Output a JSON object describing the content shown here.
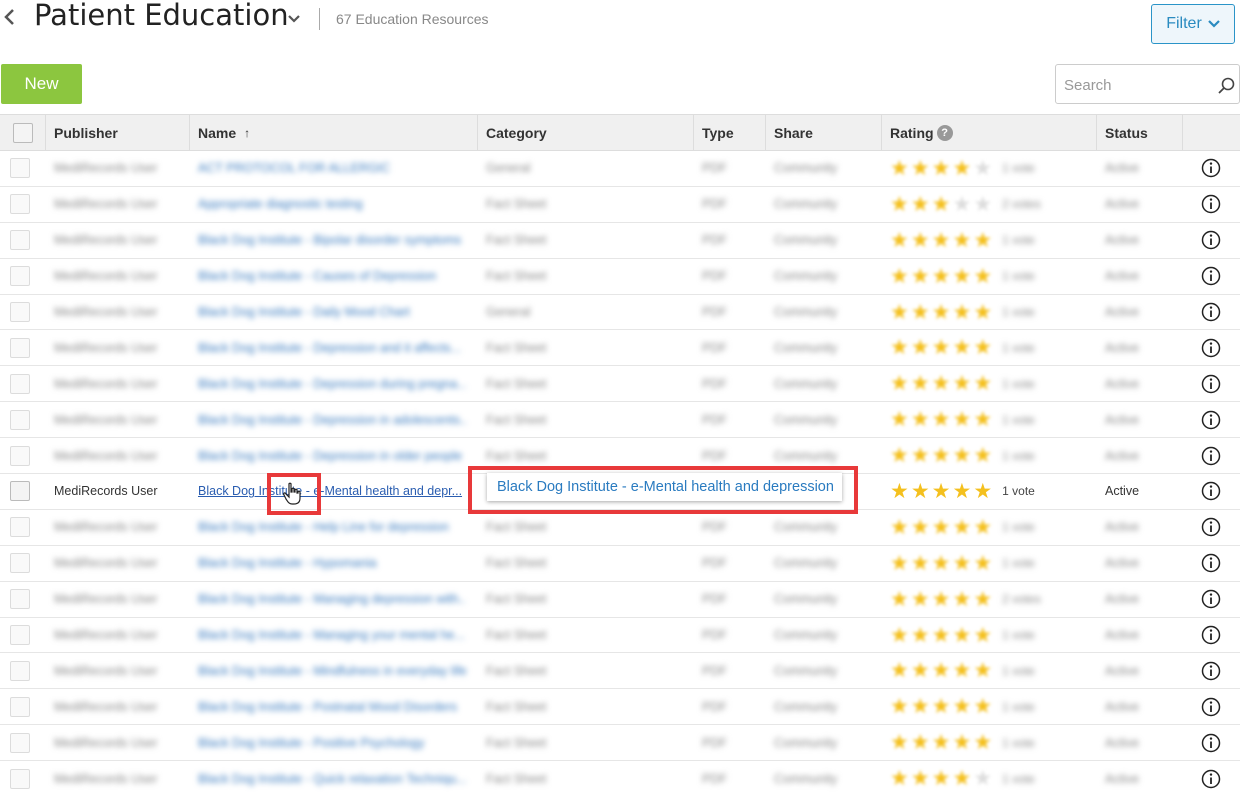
{
  "header": {
    "title": "Patient Education",
    "resource_count": "67 Education Resources",
    "filter_label": "Filter"
  },
  "toolbar": {
    "new_label": "New",
    "search_placeholder": "Search"
  },
  "columns": {
    "publisher": "Publisher",
    "name": "Name",
    "name_sort": "↑",
    "category": "Category",
    "type": "Type",
    "share": "Share",
    "rating": "Rating",
    "rating_help": "?",
    "status": "Status"
  },
  "active_row": {
    "publisher": "MediRecords User",
    "name": "Black Dog Institute - e-Mental health and depr...",
    "rating": 5,
    "votes": "1 vote",
    "status": "Active"
  },
  "tooltip": {
    "text": "Black Dog Institute - e-Mental health and depression"
  },
  "rows": [
    {
      "publisher": "MediRecords User",
      "name": "ACT PROTOCOL FOR ALLERGIC",
      "category": "General",
      "type": "PDF",
      "share": "Community",
      "rating": 4,
      "votes": "1 vote",
      "status": "Active"
    },
    {
      "publisher": "MediRecords User",
      "name": "Appropriate diagnostic testing",
      "category": "Fact Sheet",
      "type": "PDF",
      "share": "Community",
      "rating": 3,
      "votes": "2 votes",
      "status": "Active"
    },
    {
      "publisher": "MediRecords User",
      "name": "Black Dog Institute - Bipolar disorder symptoms",
      "category": "Fact Sheet",
      "type": "PDF",
      "share": "Community",
      "rating": 5,
      "votes": "1 vote",
      "status": "Active"
    },
    {
      "publisher": "MediRecords User",
      "name": "Black Dog Institute - Causes of Depression",
      "category": "Fact Sheet",
      "type": "PDF",
      "share": "Community",
      "rating": 5,
      "votes": "1 vote",
      "status": "Active"
    },
    {
      "publisher": "MediRecords User",
      "name": "Black Dog Institute - Daily Mood Chart",
      "category": "General",
      "type": "PDF",
      "share": "Community",
      "rating": 5,
      "votes": "1 vote",
      "status": "Active"
    },
    {
      "publisher": "MediRecords User",
      "name": "Black Dog Institute - Depression and it affects...",
      "category": "Fact Sheet",
      "type": "PDF",
      "share": "Community",
      "rating": 5,
      "votes": "1 vote",
      "status": "Active"
    },
    {
      "publisher": "MediRecords User",
      "name": "Black Dog Institute - Depression during pregna...",
      "category": "Fact Sheet",
      "type": "PDF",
      "share": "Community",
      "rating": 5,
      "votes": "1 vote",
      "status": "Active"
    },
    {
      "publisher": "MediRecords User",
      "name": "Black Dog Institute - Depression in adolescents...",
      "category": "Fact Sheet",
      "type": "PDF",
      "share": "Community",
      "rating": 5,
      "votes": "1 vote",
      "status": "Active"
    },
    {
      "publisher": "MediRecords User",
      "name": "Black Dog Institute - Depression in older people",
      "category": "Fact Sheet",
      "type": "PDF",
      "share": "Community",
      "rating": 5,
      "votes": "1 vote",
      "status": "Active"
    },
    {
      "publisher": "MediRecords User",
      "name": "Black Dog Institute - Help Line for depression",
      "category": "Fact Sheet",
      "type": "PDF",
      "share": "Community",
      "rating": 5,
      "votes": "1 vote",
      "status": "Active"
    },
    {
      "publisher": "MediRecords User",
      "name": "Black Dog Institute - Hypomania",
      "category": "Fact Sheet",
      "type": "PDF",
      "share": "Community",
      "rating": 5,
      "votes": "1 vote",
      "status": "Active"
    },
    {
      "publisher": "MediRecords User",
      "name": "Black Dog Institute - Managing depression with...",
      "category": "Fact Sheet",
      "type": "PDF",
      "share": "Community",
      "rating": 5,
      "votes": "2 votes",
      "status": "Active"
    },
    {
      "publisher": "MediRecords User",
      "name": "Black Dog Institute - Managing your mental he...",
      "category": "Fact Sheet",
      "type": "PDF",
      "share": "Community",
      "rating": 5,
      "votes": "1 vote",
      "status": "Active"
    },
    {
      "publisher": "MediRecords User",
      "name": "Black Dog Institute - Mindfulness in everyday life",
      "category": "Fact Sheet",
      "type": "PDF",
      "share": "Community",
      "rating": 5,
      "votes": "1 vote",
      "status": "Active"
    },
    {
      "publisher": "MediRecords User",
      "name": "Black Dog Institute - Postnatal Mood Disorders",
      "category": "Fact Sheet",
      "type": "PDF",
      "share": "Community",
      "rating": 5,
      "votes": "1 vote",
      "status": "Active"
    },
    {
      "publisher": "MediRecords User",
      "name": "Black Dog Institute - Positive Psychology",
      "category": "Fact Sheet",
      "type": "PDF",
      "share": "Community",
      "rating": 5,
      "votes": "1 vote",
      "status": "Active"
    },
    {
      "publisher": "MediRecords User",
      "name": "Black Dog Institute - Quick relaxation Techniqu...",
      "category": "Fact Sheet",
      "type": "PDF",
      "share": "Community",
      "rating": 4,
      "votes": "1 vote",
      "status": "Active"
    }
  ],
  "icons": {
    "back": "chevron-left-icon",
    "title_dropdown": "chevron-down-icon",
    "search": "search-icon",
    "info": "info-icon",
    "cursor": "hand-pointer-icon"
  },
  "colors": {
    "new_button": "#8cc63f",
    "link": "#2a5db0",
    "star": "#f4c01e",
    "highlight": "#e8393a",
    "filter_border": "#2a94c8"
  }
}
